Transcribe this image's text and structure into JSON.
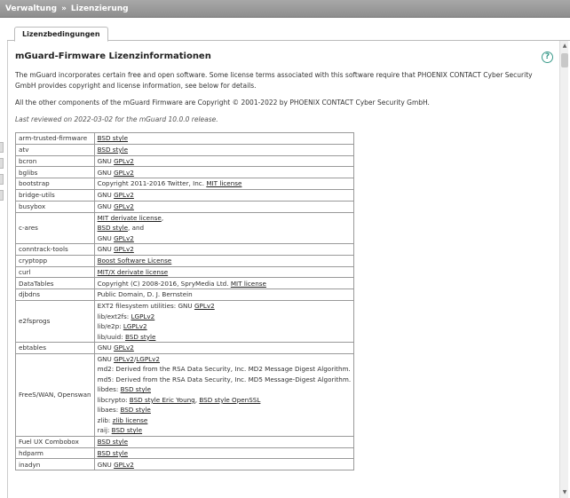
{
  "breadcrumb": {
    "part1": "Verwaltung",
    "separator": "»",
    "part2": "Lizenzierung"
  },
  "tabs": [
    {
      "label": "Lizenzbedingungen"
    }
  ],
  "page": {
    "title": "mGuard-Firmware Lizenzinformationen",
    "help_symbol": "?",
    "intro": "The mGuard incorporates certain free and open software. Some license terms associated with this software require that PHOENIX CONTACT Cyber Security GmbH provides copyright and license information, see below for details.",
    "copyright": "All the other components of the mGuard Firmware are Copyright © 2001-2022 by PHOENIX CONTACT Cyber Security GmbH.",
    "reviewed": "Last reviewed on 2022-03-02 for the mGuard 10.0.0 release."
  },
  "licenses": [
    {
      "name": "arm-trusted-firmware",
      "lines": [
        [
          {
            "t": "BSD style",
            "u": true
          }
        ]
      ]
    },
    {
      "name": "atv",
      "lines": [
        [
          {
            "t": "BSD style",
            "u": true
          }
        ]
      ]
    },
    {
      "name": "bcron",
      "lines": [
        [
          {
            "t": "GNU "
          },
          {
            "t": "GPLv2",
            "u": true
          }
        ]
      ]
    },
    {
      "name": "bglibs",
      "lines": [
        [
          {
            "t": "GNU "
          },
          {
            "t": "GPLv2",
            "u": true
          }
        ]
      ]
    },
    {
      "name": "bootstrap",
      "lines": [
        [
          {
            "t": "Copyright 2011-2016 Twitter, Inc. "
          },
          {
            "t": "MIT license",
            "u": true
          }
        ]
      ]
    },
    {
      "name": "bridge-utils",
      "lines": [
        [
          {
            "t": "GNU "
          },
          {
            "t": "GPLv2",
            "u": true
          }
        ]
      ]
    },
    {
      "name": "busybox",
      "lines": [
        [
          {
            "t": "GNU "
          },
          {
            "t": "GPLv2",
            "u": true
          }
        ]
      ]
    },
    {
      "name": "c-ares",
      "lines": [
        [
          {
            "t": "MIT derivate license",
            "u": true
          },
          {
            "t": ","
          }
        ],
        [
          {
            "t": "BSD style",
            "u": true
          },
          {
            "t": ", and"
          }
        ],
        [
          {
            "t": "GNU "
          },
          {
            "t": "GPLv2",
            "u": true
          }
        ]
      ]
    },
    {
      "name": "conntrack-tools",
      "lines": [
        [
          {
            "t": "GNU "
          },
          {
            "t": "GPLv2",
            "u": true
          }
        ]
      ]
    },
    {
      "name": "cryptopp",
      "lines": [
        [
          {
            "t": "Boost Software License",
            "u": true
          }
        ]
      ]
    },
    {
      "name": "curl",
      "lines": [
        [
          {
            "t": "MIT/X derivate license",
            "u": true
          }
        ]
      ]
    },
    {
      "name": "DataTables",
      "lines": [
        [
          {
            "t": "Copyright (C) 2008-2016, SpryMedia Ltd. "
          },
          {
            "t": "MIT license",
            "u": true
          }
        ]
      ]
    },
    {
      "name": "djbdns",
      "lines": [
        [
          {
            "t": "Public Domain, D. J. Bernstein"
          }
        ]
      ]
    },
    {
      "name": "e2fsprogs",
      "lines": [
        [
          {
            "t": "EXT2 filesystem utilities: GNU "
          },
          {
            "t": "GPLv2",
            "u": true
          }
        ],
        [
          {
            "t": "lib/ext2fs: "
          },
          {
            "t": "LGPLv2",
            "u": true
          }
        ],
        [
          {
            "t": "lib/e2p: "
          },
          {
            "t": "LGPLv2",
            "u": true
          }
        ],
        [
          {
            "t": "lib/uuid: "
          },
          {
            "t": "BSD style",
            "u": true
          }
        ]
      ]
    },
    {
      "name": "ebtables",
      "lines": [
        [
          {
            "t": "GNU "
          },
          {
            "t": "GPLv2",
            "u": true
          }
        ]
      ]
    },
    {
      "name": "FreeS/WAN, Openswan",
      "lines": [
        [
          {
            "t": "GNU "
          },
          {
            "t": "GPLv2",
            "u": true
          },
          {
            "t": "/"
          },
          {
            "t": "LGPLv2",
            "u": true
          }
        ],
        [
          {
            "t": "md2: Derived from the RSA Data Security, Inc. MD2 Message Digest Algorithm."
          }
        ],
        [
          {
            "t": "md5: Derived from the RSA Data Security, Inc. MD5 Message-Digest Algorithm."
          }
        ],
        [
          {
            "t": "libdes: "
          },
          {
            "t": "BSD style",
            "u": true
          }
        ],
        [
          {
            "t": "libcrypto: "
          },
          {
            "t": "BSD style Eric Young",
            "u": true
          },
          {
            "t": ", "
          },
          {
            "t": "BSD style OpenSSL",
            "u": true
          }
        ],
        [
          {
            "t": "libaes: "
          },
          {
            "t": "BSD style",
            "u": true
          }
        ],
        [
          {
            "t": "zlib: "
          },
          {
            "t": "zlib license",
            "u": true
          }
        ],
        [
          {
            "t": "raij: "
          },
          {
            "t": "BSD style",
            "u": true
          }
        ]
      ]
    },
    {
      "name": "Fuel UX Combobox",
      "lines": [
        [
          {
            "t": "BSD style",
            "u": true
          }
        ]
      ]
    },
    {
      "name": "hdparm",
      "lines": [
        [
          {
            "t": "BSD style",
            "u": true
          }
        ]
      ]
    },
    {
      "name": "inadyn",
      "lines": [
        [
          {
            "t": "GNU "
          },
          {
            "t": "GPLv2",
            "u": true
          }
        ]
      ]
    }
  ]
}
